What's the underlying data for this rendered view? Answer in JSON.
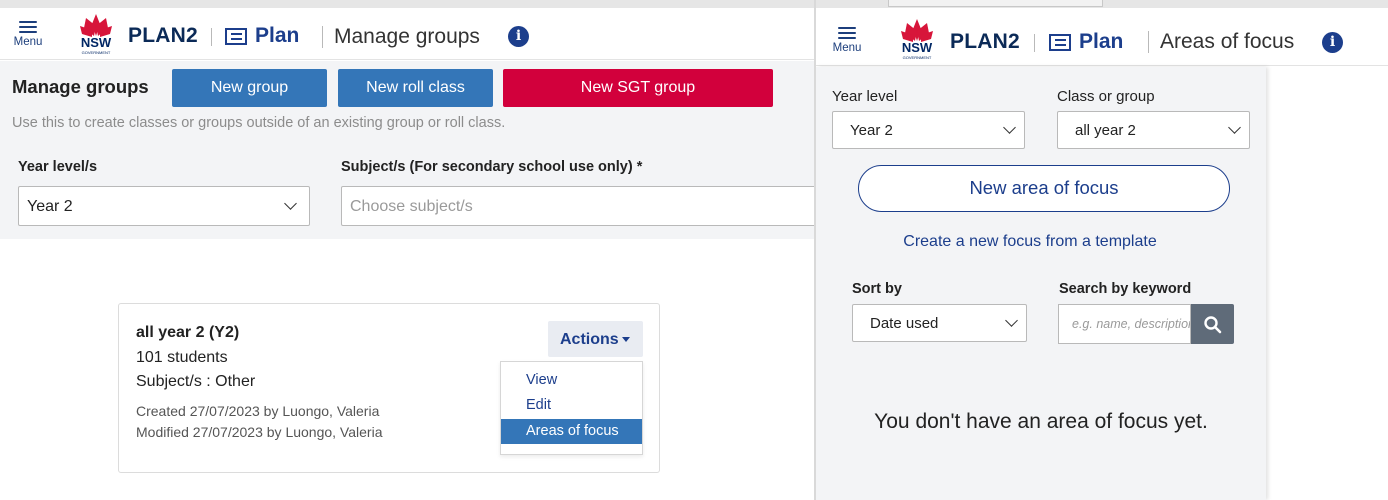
{
  "left": {
    "menu_label": "Menu",
    "brand_text": "PLAN2",
    "logo_text": "NSW",
    "logo_sub": "GOVERNMENT",
    "plan_label": "Plan",
    "page_title": "Manage groups",
    "info_icon": "i",
    "toolbar": {
      "title": "Manage groups",
      "new_group": "New group",
      "new_roll_class": "New roll class",
      "new_sgt_group": "New SGT group",
      "hint": "Use this to create classes or groups outside of an existing group or roll class."
    },
    "filters": {
      "year_label": "Year level/s",
      "year_value": "Year 2",
      "subject_label": "Subject/s (For secondary school use only) *",
      "subject_placeholder": "Choose subject/s"
    },
    "card": {
      "title": "all year 2 (Y2)",
      "students": "101 students",
      "subjects": "Subject/s : Other",
      "created": "Created 27/07/2023 by Luongo, Valeria",
      "modified": "Modified 27/07/2023 by Luongo, Valeria",
      "actions_label": "Actions",
      "menu_items": [
        "View",
        "Edit",
        "Areas of focus"
      ]
    },
    "colors": {
      "primary": "#3476b8",
      "sgt": "#d2003c",
      "navy": "#1c3e8c"
    }
  },
  "right": {
    "menu_label": "Menu",
    "brand_text": "PLAN2",
    "logo_text": "NSW",
    "logo_sub": "GOVERNMENT",
    "plan_label": "Plan",
    "page_title": "Areas of focus",
    "info_icon": "i",
    "year_label": "Year level",
    "year_value": "Year 2",
    "class_label": "Class or group",
    "class_value": "all year 2",
    "new_area_button": "New area of focus",
    "template_link": "Create a new focus from a template",
    "sort_label": "Sort by",
    "sort_value": "Date used",
    "search_label": "Search by keyword",
    "search_placeholder": "e.g. name, description",
    "empty_message": "You don't have an area of focus yet."
  }
}
